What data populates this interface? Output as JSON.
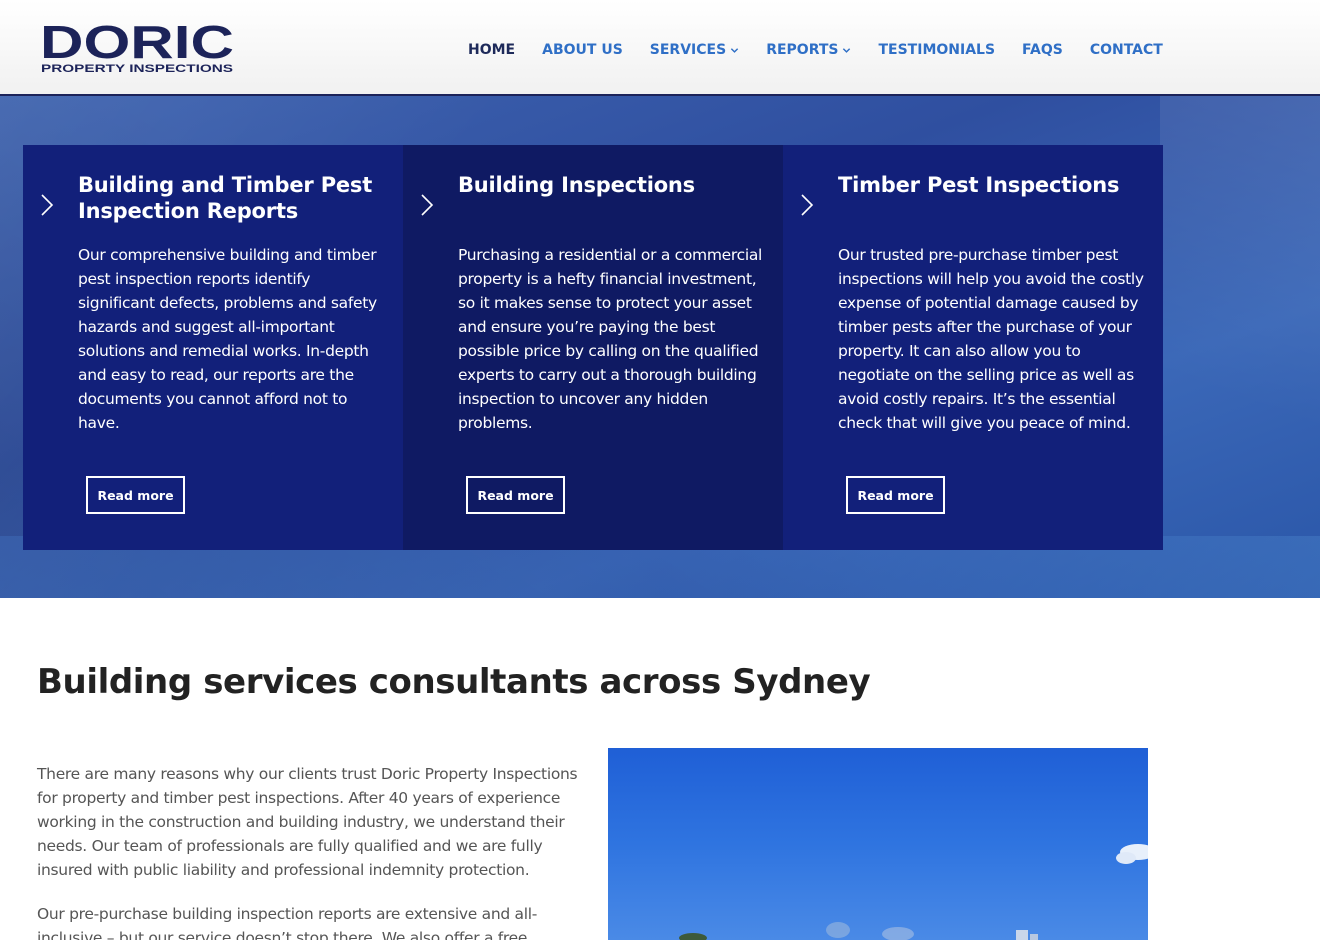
{
  "brand": {
    "logo_main": "DORIC",
    "logo_sub": "PROPERTY INSPECTIONS",
    "navy": "#1c2359",
    "blue": "#2f6fc6"
  },
  "nav": {
    "items": [
      {
        "label": "HOME",
        "active": true,
        "dropdown": false
      },
      {
        "label": "ABOUT US",
        "active": false,
        "dropdown": false
      },
      {
        "label": "SERVICES",
        "active": false,
        "dropdown": true
      },
      {
        "label": "REPORTS",
        "active": false,
        "dropdown": true
      },
      {
        "label": "TESTIMONIALS",
        "active": false,
        "dropdown": false
      },
      {
        "label": "FAQS",
        "active": false,
        "dropdown": false
      },
      {
        "label": "CONTACT",
        "active": false,
        "dropdown": false
      }
    ]
  },
  "cards": [
    {
      "title": "Building and Timber Pest Inspection Reports",
      "text": "Our comprehensive building and timber pest inspection reports identify significant defects, problems and safety hazards and suggest all-important solutions and remedial works. In-depth and easy to read, our reports are the documents you cannot afford not to have.",
      "button": "Read more",
      "icon": "chevron-right-icon"
    },
    {
      "title": "Building Inspections",
      "text": "Purchasing a residential or a commercial property is a hefty financial investment, so it makes sense to protect your asset and ensure you’re paying the best possible price by calling on the qualified experts to carry out a thorough building inspection to uncover any hidden problems.",
      "button": "Read more",
      "icon": "chevron-right-icon"
    },
    {
      "title": "Timber Pest Inspections",
      "text": "Our trusted pre-purchase timber pest inspections will help you avoid the costly expense of potential damage caused by timber pests after the purchase of your property. It can also allow you to negotiate on the selling price as well as avoid costly repairs. It’s the essential check that will give you peace of mind.",
      "button": "Read more",
      "icon": "chevron-right-icon"
    }
  ],
  "main": {
    "title": "Building services consultants across Sydney",
    "paragraphs": [
      "There are many reasons why our clients trust Doric Property Inspections for property and timber pest inspections. After 40 years of experience working in the construction and building industry, we understand their needs. Our team of professionals are fully qualified and we are fully insured with public liability and professional indemnity protection.",
      "Our pre-purchase building inspection reports are extensive and all-inclusive – but our service doesn’t stop there. We also offer a free"
    ]
  }
}
